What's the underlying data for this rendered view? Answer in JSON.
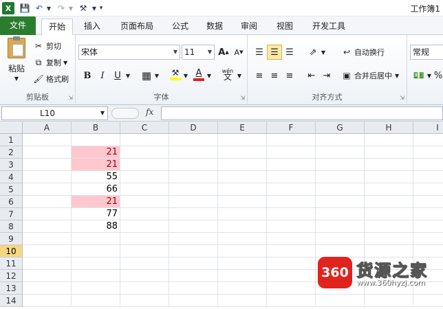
{
  "window": {
    "title": "工作簿1"
  },
  "tabs": [
    "文件",
    "开始",
    "插入",
    "页面布局",
    "公式",
    "数据",
    "审阅",
    "视图",
    "开发工具"
  ],
  "active_tab": "开始",
  "ribbon": {
    "clipboard": {
      "label": "剪贴板",
      "paste": "粘贴",
      "cut": "剪切",
      "copy": "复制",
      "format_painter": "格式刷"
    },
    "font": {
      "label": "字体",
      "name": "宋体",
      "size": "11",
      "bold": "B",
      "italic": "I",
      "underline": "U",
      "wen": "wén"
    },
    "alignment": {
      "label": "对齐方式",
      "wrap_text": "自动换行",
      "merge_center": "合并后居中"
    },
    "number": {
      "format": "常规"
    }
  },
  "formula_bar": {
    "name_box": "L10",
    "fx": "fx",
    "content": ""
  },
  "grid": {
    "columns": [
      "A",
      "B",
      "C",
      "D",
      "E",
      "F",
      "G",
      "H",
      "I"
    ],
    "rows": [
      "1",
      "2",
      "3",
      "4",
      "5",
      "6",
      "7",
      "8",
      "9",
      "10",
      "11",
      "12",
      "13",
      "14"
    ],
    "selected_row": "10",
    "column_b": [
      "",
      "21",
      "21",
      "55",
      "66",
      "21",
      "77",
      "88",
      "",
      "",
      "",
      "",
      "",
      ""
    ],
    "highlighted_rows": [
      "2",
      "3",
      "6"
    ],
    "highlight_color": "#ffc7ce"
  },
  "watermark": {
    "badge": "360",
    "name": "货源之家",
    "url": "www.360hyzj.com"
  }
}
